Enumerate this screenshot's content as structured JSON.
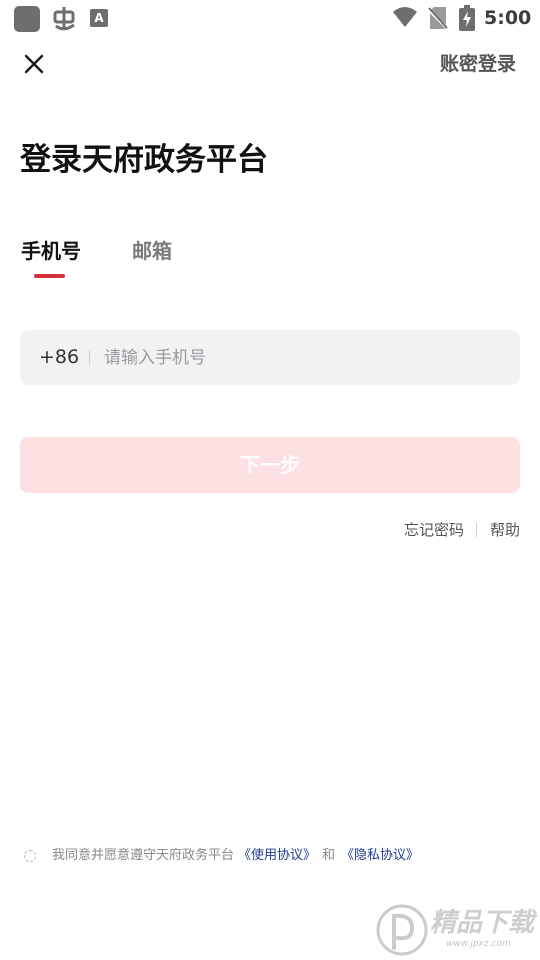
{
  "status_bar": {
    "time": "5:00",
    "icons": [
      "app-square-icon",
      "bug-icon",
      "keyboard-a-icon",
      "wifi-icon",
      "no-sim-icon",
      "battery-charging-icon"
    ]
  },
  "header": {
    "close_icon": "close-icon",
    "account_login": "账密登录"
  },
  "title": "登录天府政务平台",
  "tabs": [
    {
      "label": "手机号",
      "active": true
    },
    {
      "label": "邮箱",
      "active": false
    }
  ],
  "phone": {
    "country_code": "+86",
    "value": "",
    "placeholder": "请输入手机号"
  },
  "next_button": "下一步",
  "links": {
    "forgot": "忘记密码",
    "help": "帮助"
  },
  "agreement": {
    "text": "我同意并愿意遵守天府政务平台",
    "terms": "《使用协议》",
    "and": "和",
    "privacy": "《隐私协议》"
  },
  "watermark": {
    "brand": "精品下载",
    "url": "www.jpxz.com"
  },
  "colors": {
    "accent": "#d4303c",
    "button_disabled_bg": "#fde0e2",
    "input_bg": "#f2f2f4",
    "link": "#1f3a93"
  }
}
